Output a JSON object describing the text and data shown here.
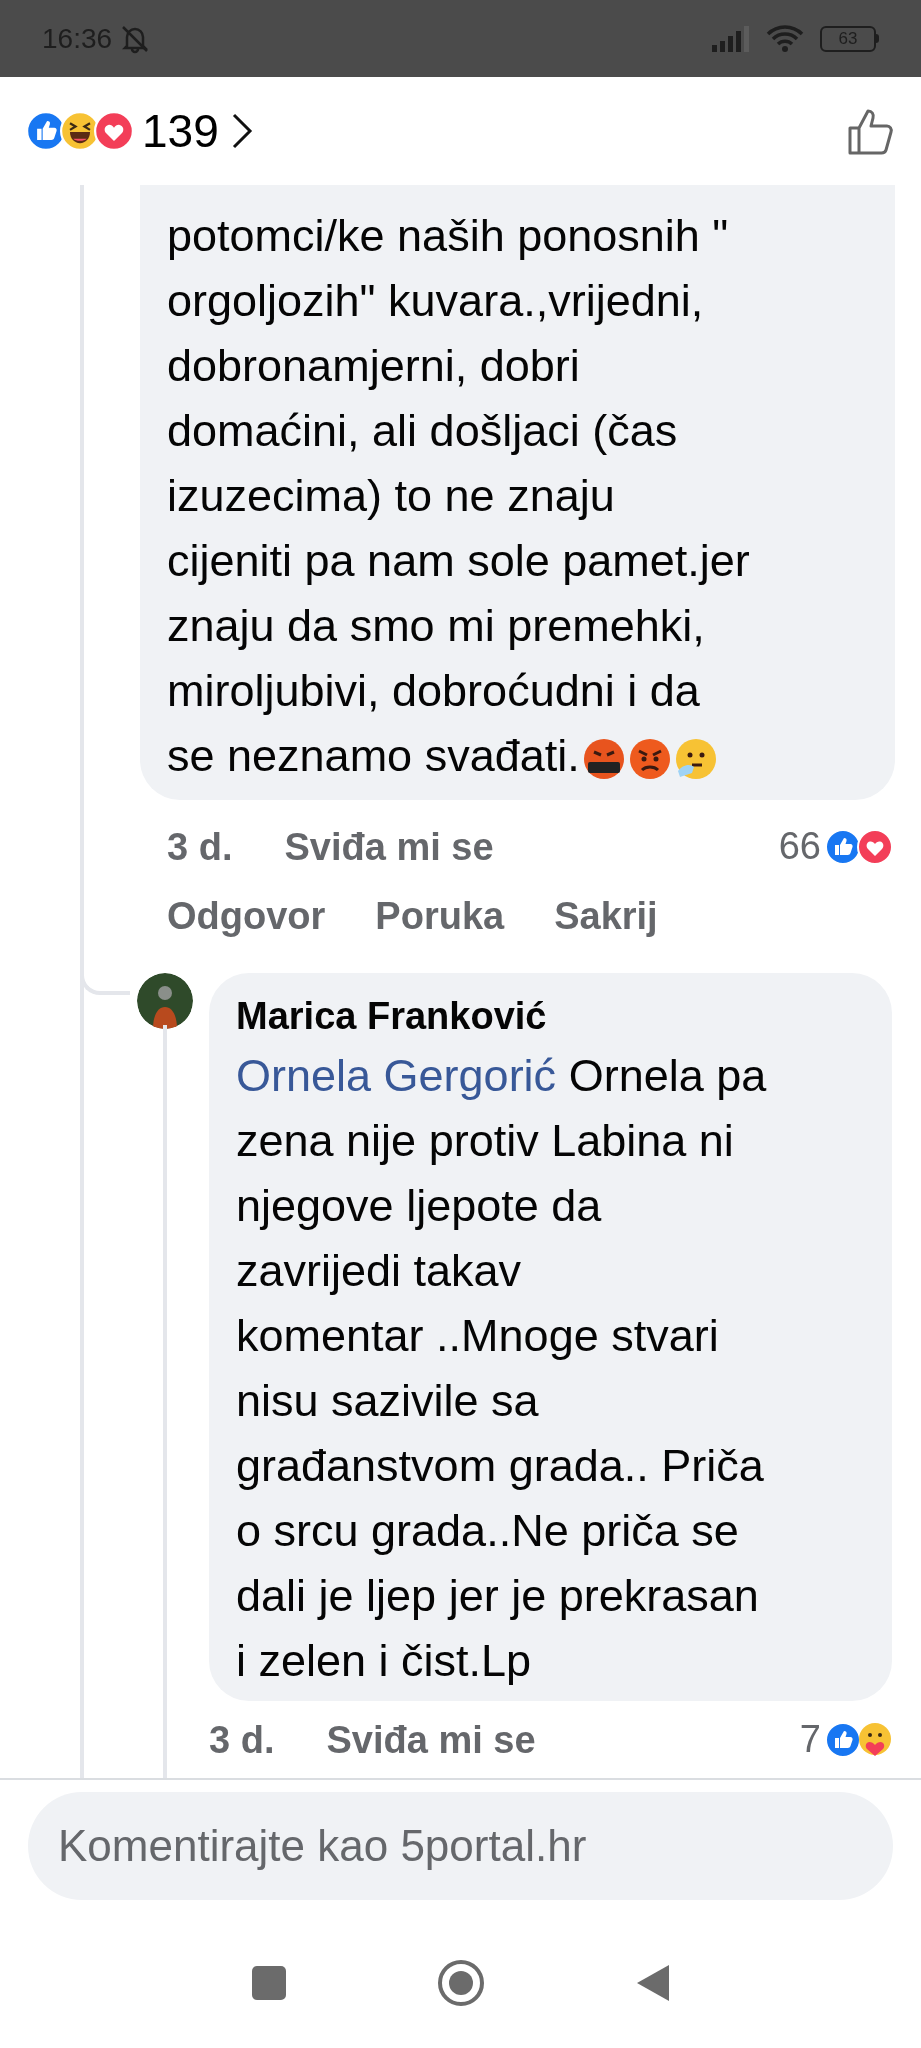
{
  "status_bar": {
    "time": "16:36",
    "battery": "63"
  },
  "header": {
    "reaction_count": "139"
  },
  "comment": {
    "text": "potomci/ke naših ponosnih \"\norgoljozih\" kuvara.,vrijedni,\ndobronamjerni, dobri\ndomaćini, ali došljaci (čas\nizuzecima) to ne znaju\ncijeniti pa nam sole pamet.jer\nznaju da smo mi premehki,\nmiroljubivi, dobroćudni i da\nse neznamo svađati.",
    "time": "3 d.",
    "like_label": "Sviđa mi se",
    "reaction_count": "66",
    "actions": [
      "Odgovor",
      "Poruka",
      "Sakrij"
    ]
  },
  "reply": {
    "author": "Marica Franković",
    "mention": "Ornela Gergorić",
    "text": "Ornela pa\nzena nije protiv Labina ni\nnjegove ljepote da\nzavrijedi takav\nkomentar ..Mnoge stvari\nnisu sazivile sa\ngrađanstvom grada.. Priča\no srcu grada..Ne priča se\ndali je ljep jer je prekrasan\ni zelen i čist.Lp",
    "time": "3 d.",
    "like_label": "Sviđa mi se",
    "reaction_count": "7"
  },
  "composer": {
    "placeholder": "Komentirajte kao 5portal.hr"
  }
}
